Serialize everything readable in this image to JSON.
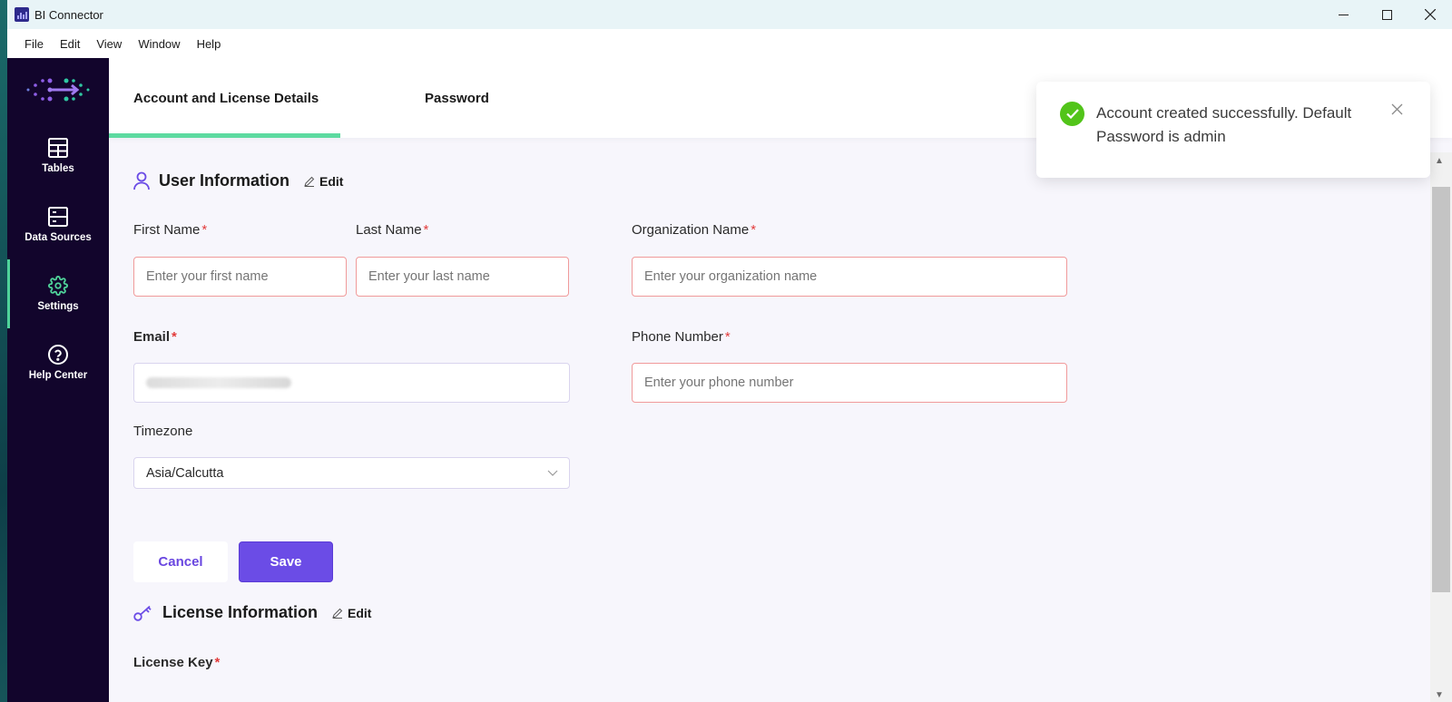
{
  "window": {
    "title": "BI Connector"
  },
  "menu": [
    "File",
    "Edit",
    "View",
    "Window",
    "Help"
  ],
  "sidebar": {
    "items": [
      {
        "label": "Tables",
        "icon": "table-icon"
      },
      {
        "label": "Data Sources",
        "icon": "data-sources-icon"
      },
      {
        "label": "Settings",
        "icon": "gear-icon",
        "active": true
      },
      {
        "label": "Help Center",
        "icon": "help-circle-icon"
      }
    ]
  },
  "tabs": [
    {
      "label": "Account and License Details",
      "active": true
    },
    {
      "label": "Password"
    }
  ],
  "user_info": {
    "title": "User Information",
    "edit_label": "Edit",
    "first_name": {
      "label": "First Name",
      "placeholder": "Enter your first name"
    },
    "last_name": {
      "label": "Last Name",
      "placeholder": "Enter your last name"
    },
    "org_name": {
      "label": "Organization Name",
      "placeholder": "Enter your organization name"
    },
    "email": {
      "label": "Email"
    },
    "phone": {
      "label": "Phone Number",
      "placeholder": "Enter your phone number"
    },
    "timezone": {
      "label": "Timezone",
      "value": "Asia/Calcutta"
    },
    "required_mark": "*"
  },
  "buttons": {
    "cancel": "Cancel",
    "save": "Save"
  },
  "license_info": {
    "title": "License Information",
    "edit_label": "Edit",
    "license_key": {
      "label": "License Key"
    }
  },
  "toast": {
    "message": "Account created successfully. Default Password is admin"
  },
  "colors": {
    "sidebar_bg": "#12052c",
    "accent_green": "#5ddaa0",
    "primary_purple": "#6b4ce6",
    "required_red": "#e23b3b",
    "success_green": "#52c41a"
  }
}
